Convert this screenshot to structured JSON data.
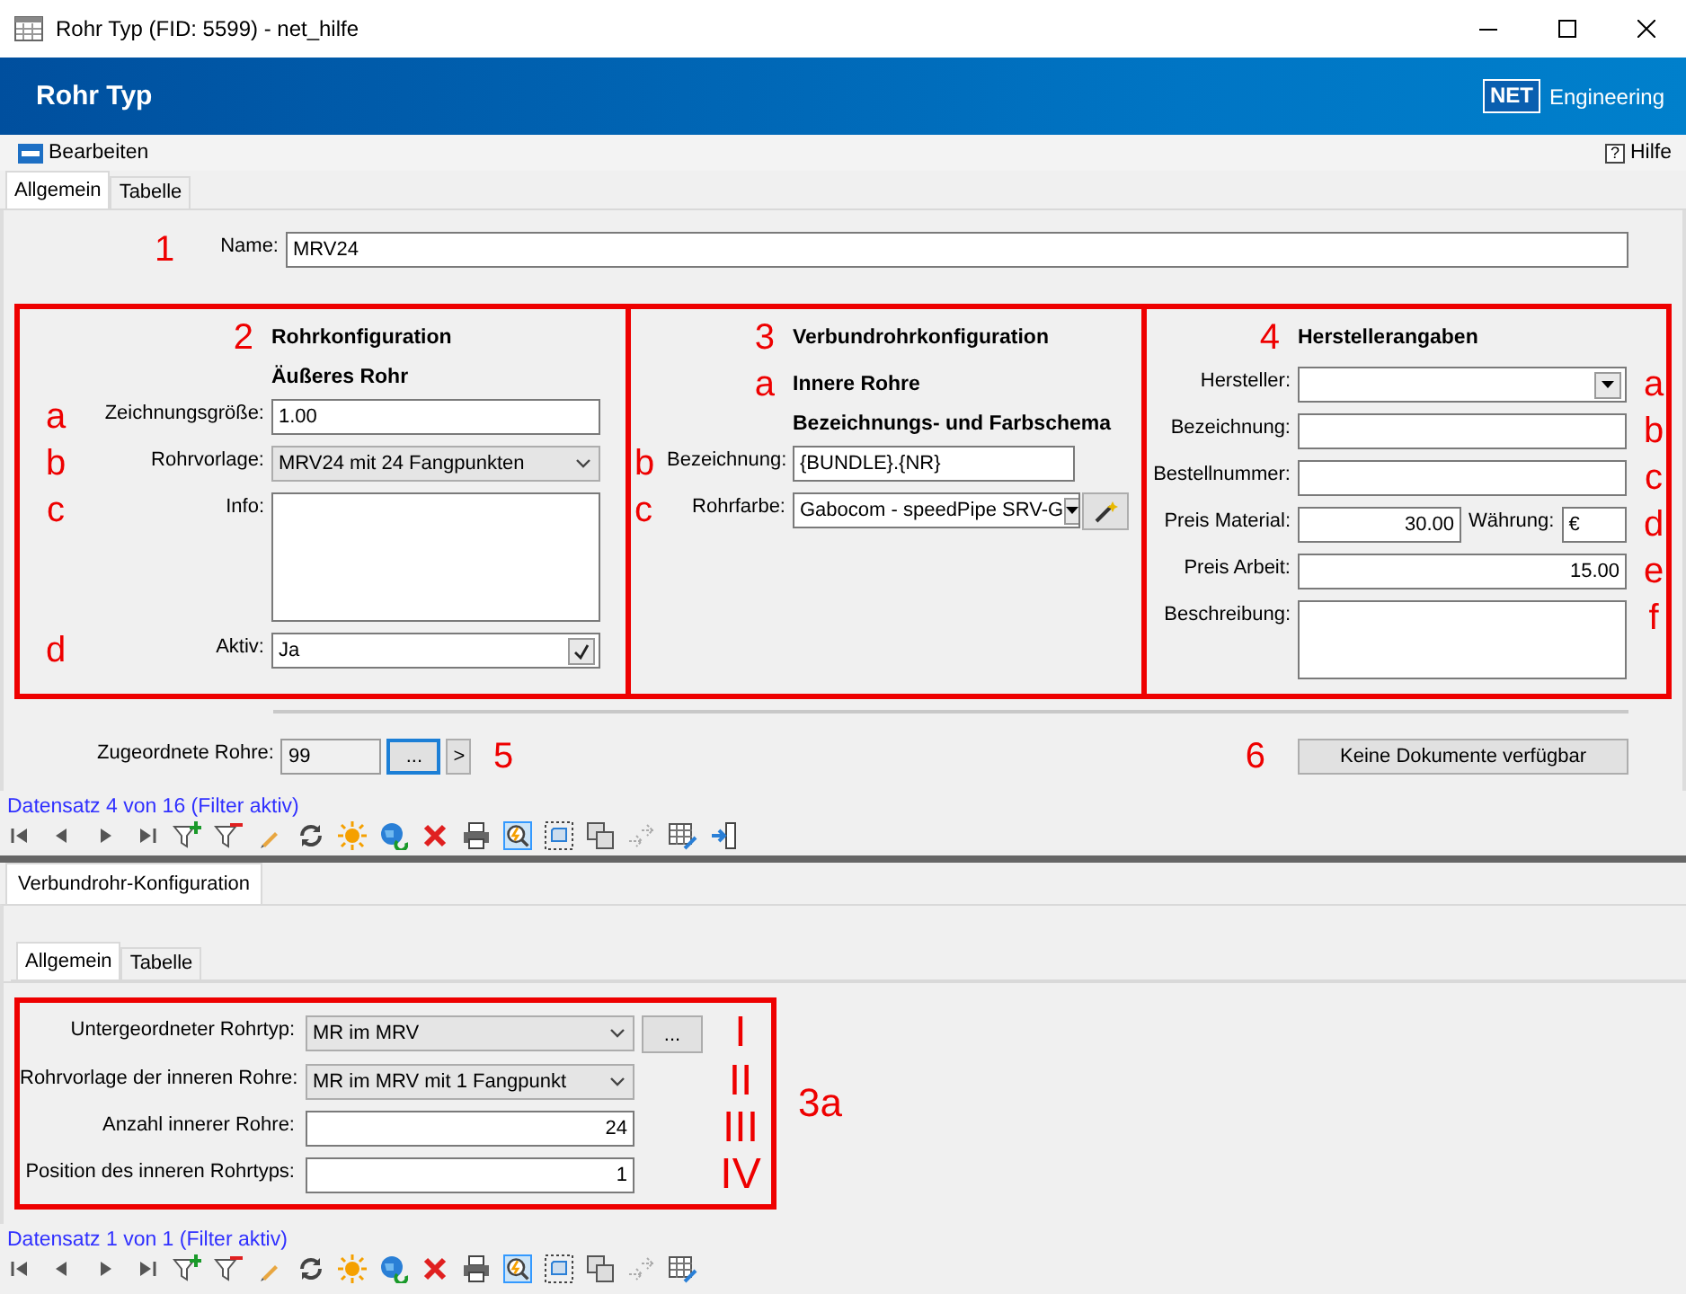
{
  "window": {
    "title": "Rohr Typ (FID: 5599) - net_hilfe"
  },
  "header": {
    "title": "Rohr Typ",
    "logo_mark": "NET",
    "logo_text": "Engineering"
  },
  "menu": {
    "items": [
      {
        "label": "Bearbeiten"
      }
    ],
    "help": {
      "icon": "?",
      "label": "Hilfe"
    }
  },
  "tabs": [
    {
      "label": "Allgemein",
      "selected": true
    },
    {
      "label": "Tabelle",
      "selected": false
    }
  ],
  "name_field": {
    "marker": "1",
    "label": "Name:",
    "value": "MRV24"
  },
  "sections": [
    {
      "kind": "outer",
      "marker": "2",
      "title": "Rohrkonfiguration",
      "subtitles": [
        {
          "text": "Äußeres Rohr"
        }
      ],
      "fields": [
        {
          "marker": "a",
          "label": "Zeichnungsgröße:",
          "kind": "text",
          "value": "1.00"
        },
        {
          "marker": "b",
          "label": "Rohrvorlage:",
          "kind": "combo",
          "value": "MRV24 mit 24 Fangpunkten"
        },
        {
          "marker": "c",
          "label": "Info:",
          "kind": "memo"
        },
        {
          "marker": "d",
          "label": "Aktiv:",
          "kind": "check",
          "value": "Ja",
          "checked": true
        }
      ]
    },
    {
      "kind": "composite",
      "marker": "3",
      "title": "Verbundrohrkonfiguration",
      "subtitles": [
        {
          "marker": "a",
          "text": "Innere Rohre"
        },
        {
          "text": "Bezeichnungs- und Farbschema"
        }
      ],
      "fields": [
        {
          "marker": "b",
          "label": "Bezeichnung:",
          "kind": "text",
          "value": "{BUNDLE}.{NR}"
        },
        {
          "marker": "c",
          "label": "Rohrfarbe:",
          "kind": "color-dropdown",
          "value": "Gabocom - speedPipe SRV-G"
        }
      ]
    },
    {
      "kind": "vendor",
      "marker": "4",
      "title": "Herstellerangaben",
      "fields": [
        {
          "marker": "a",
          "label": "Hersteller:",
          "kind": "dropdown"
        },
        {
          "marker": "b",
          "label": "Bezeichnung:",
          "kind": "text"
        },
        {
          "marker": "c",
          "label": "Bestellnummer:",
          "kind": "text"
        },
        {
          "marker": "d",
          "label": "Preis Material:",
          "kind": "number",
          "value": "30.00",
          "extra": {
            "label": "Währung:",
            "value": "€"
          }
        },
        {
          "marker": "e",
          "label": "Preis Arbeit:",
          "kind": "number",
          "value": "15.00"
        },
        {
          "marker": "f",
          "label": "Beschreibung:",
          "kind": "memo"
        }
      ]
    }
  ],
  "assigned": {
    "label": "Zugeordnete Rohre:",
    "value": "99",
    "browse": "...",
    "next": ">",
    "marker": "5"
  },
  "documents": {
    "marker": "6",
    "button": "Keine Dokumente verfügbar"
  },
  "navigator": {
    "status": "Datensatz 4 von 16 (Filter aktiv)",
    "exit": true
  },
  "lower": {
    "tab": "Verbundrohr-Konfiguration",
    "tabs": [
      {
        "label": "Allgemein",
        "selected": true
      },
      {
        "label": "Tabelle",
        "selected": false
      }
    ],
    "marker": "3a",
    "fields": [
      {
        "marker": "I",
        "label": "Untergeordneter Rohrtyp:",
        "kind": "combo",
        "value": "MR im MRV",
        "button": "..."
      },
      {
        "marker": "II",
        "label": "Rohrvorlage der inneren Rohre:",
        "kind": "combo",
        "value": "MR im MRV mit 1 Fangpunkt"
      },
      {
        "marker": "III",
        "label": "Anzahl innerer Rohre:",
        "kind": "number",
        "value": "24"
      },
      {
        "marker": "IV",
        "label": "Position des inneren Rohrtyps:",
        "kind": "number",
        "value": "1"
      }
    ],
    "navigator": {
      "status": "Datensatz 1 von 1 (Filter aktiv)",
      "exit": false
    }
  }
}
